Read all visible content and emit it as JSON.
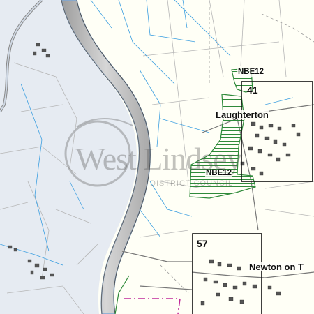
{
  "map": {
    "colors": {
      "land": "#fffff6",
      "floodplain": "#e6ebf2",
      "river_water": "#c7c7c7",
      "river_edge": "#7da7d6",
      "drain": "#3a9ee0",
      "field_boundary": "#b6b6b6",
      "designation": "#2f8a3a",
      "sheet_frame": "#111111",
      "dash_boundary": "#c0289a"
    },
    "places": {
      "laughterton": "Laughterton",
      "newton": "Newton on T"
    },
    "designations": {
      "north": "NBE12",
      "south": "NBE12"
    },
    "sheets": {
      "north": "41",
      "south": "57"
    },
    "watermark": {
      "title": "West Lindsey",
      "subtitle": "DISTRICT COUNCIL"
    }
  }
}
